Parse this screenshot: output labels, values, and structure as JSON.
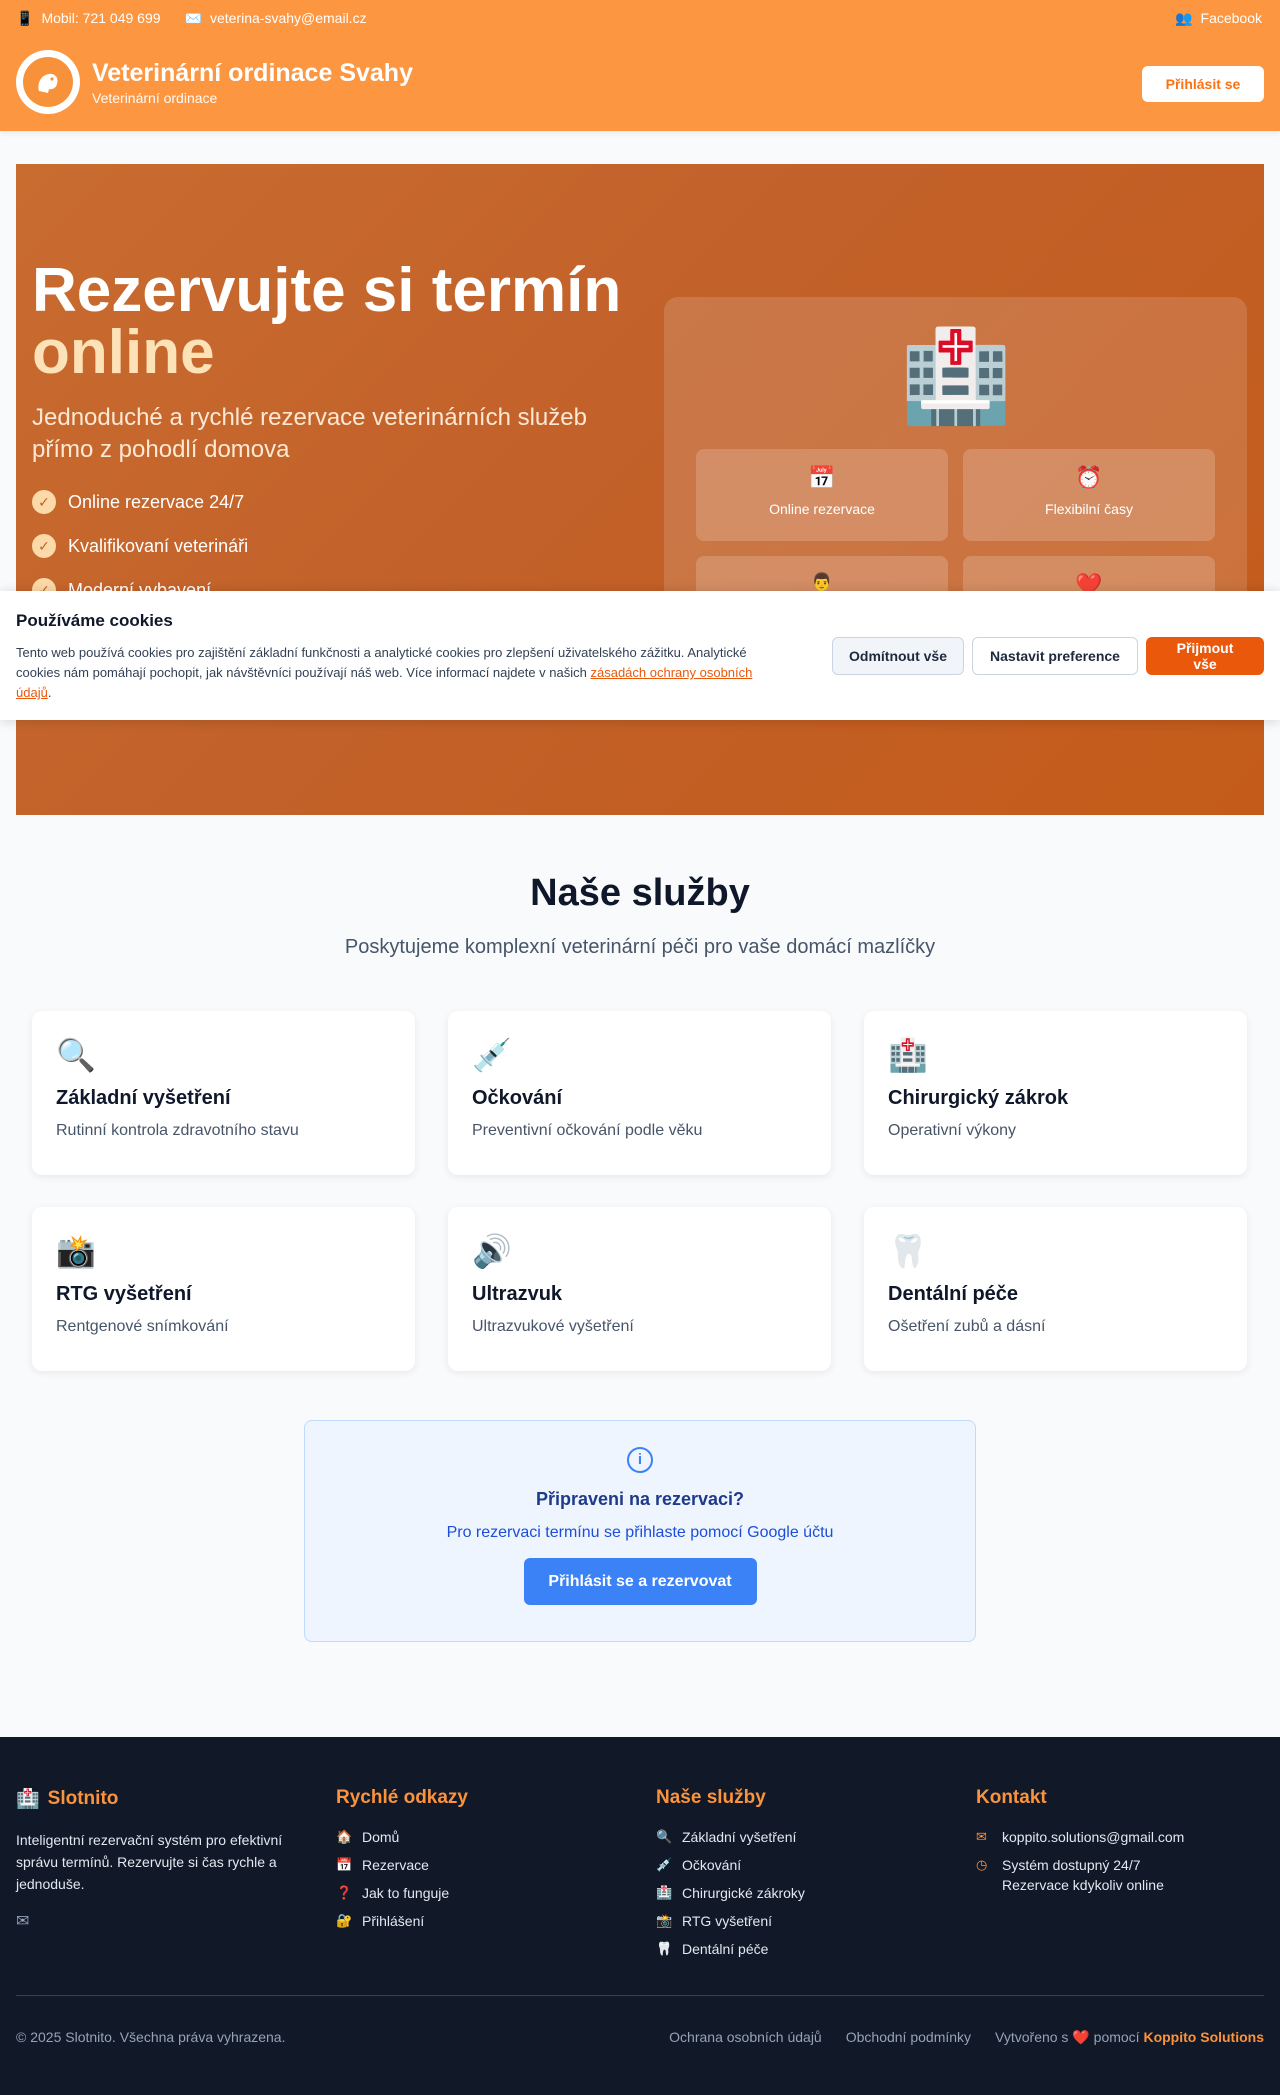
{
  "topbar": {
    "phone": "Mobil: 721 049 699",
    "email": "veterina-svahy@email.cz",
    "facebook": "Facebook"
  },
  "header": {
    "title": "Veterinární ordinace Svahy",
    "subtitle": "Veterinární ordinace",
    "login_label": "Přihlásit se"
  },
  "hero": {
    "title_line1": "Rezervujte si termín",
    "title_line2": "online",
    "lead": "Jednoduché a rychlé rezervace veterinárních služeb přímo z pohodlí domova",
    "features": [
      "Online rezervace 24/7",
      "Kvalifikovaní veterináři",
      "Moderní vybavení"
    ],
    "panel_cards": [
      {
        "icon": "📅",
        "label": "Online rezervace"
      },
      {
        "icon": "⏰",
        "label": "Flexibilní časy"
      },
      {
        "icon": "👨‍⚕️",
        "label": ""
      },
      {
        "icon": "❤️",
        "label": ""
      }
    ]
  },
  "cookie": {
    "title": "Používáme cookies",
    "text": "Tento web používá cookies pro zajištění základní funkčnosti a analytické cookies pro zlepšení uživatelského zážitku. Analytické cookies nám pomáhají pochopit, jak návštěvníci používají náš web. Více informací najdete v našich ",
    "link": "zásadách ochrany osobních údajů",
    "text_end": ".",
    "reject": "Odmítnout vše",
    "prefs": "Nastavit preference",
    "accept": "Přijmout vše"
  },
  "services": {
    "title": "Naše služby",
    "subtitle": "Poskytujeme komplexní veterinární péči pro vaše domácí mazlíčky",
    "items": [
      {
        "icon": "🔍",
        "title": "Základní vyšetření",
        "desc": "Rutinní kontrola zdravotního stavu"
      },
      {
        "icon": "💉",
        "title": "Očkování",
        "desc": "Preventivní očkování podle věku"
      },
      {
        "icon": "🏥",
        "title": "Chirurgický zákrok",
        "desc": "Operativní výkony"
      },
      {
        "icon": "📸",
        "title": "RTG vyšetření",
        "desc": "Rentgenové snímkování"
      },
      {
        "icon": "🔊",
        "title": "Ultrazvuk",
        "desc": "Ultrazvukové vyšetření"
      },
      {
        "icon": "🦷",
        "title": "Dentální péče",
        "desc": "Ošetření zubů a dásní"
      }
    ]
  },
  "cta": {
    "title": "Připraveni na rezervaci?",
    "text": "Pro rezervaci termínu se přihlaste pomocí Google účtu",
    "button": "Přihlásit se a rezervovat"
  },
  "footer": {
    "brand": "Slotnito",
    "brand_text": "Inteligentní rezervační systém pro efektivní správu termínů. Rezervujte si čas rychle a jednoduše.",
    "quick_title": "Rychlé odkazy",
    "quick_links": [
      {
        "icon": "🏠",
        "label": "Domů"
      },
      {
        "icon": "📅",
        "label": "Rezervace"
      },
      {
        "icon": "❓",
        "label": "Jak to funguje"
      },
      {
        "icon": "🔐",
        "label": "Přihlášení"
      }
    ],
    "services_title": "Naše služby",
    "services_links": [
      {
        "icon": "🔍",
        "label": "Základní vyšetření"
      },
      {
        "icon": "💉",
        "label": "Očkování"
      },
      {
        "icon": "🏥",
        "label": "Chirurgické zákroky"
      },
      {
        "icon": "📸",
        "label": "RTG vyšetření"
      },
      {
        "icon": "🦷",
        "label": "Dentální péče"
      }
    ],
    "contact_title": "Kontakt",
    "contact_email": "koppito.solutions@gmail.com",
    "contact_hours_1": "Systém dostupný 24/7",
    "contact_hours_2": "Rezervace kdykoliv online",
    "copyright": "© 2025 Slotnito. Všechna práva vyhrazena.",
    "privacy": "Ochrana osobních údajů",
    "terms": "Obchodní podmínky",
    "made_prefix": "Vytvořeno s",
    "made_mid": "pomocí",
    "made_by": "Koppito Solutions"
  }
}
